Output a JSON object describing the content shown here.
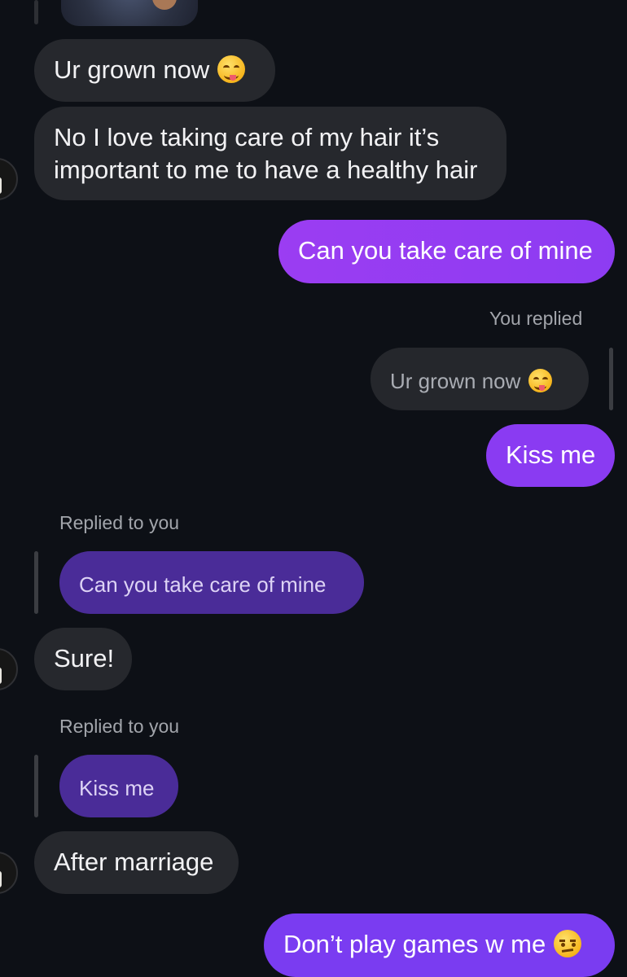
{
  "messages": {
    "m1": "Ur grown now",
    "m2_line1": "No I love taking care of my hair it’s",
    "m2_line2": "important to me to have a healthy hair",
    "m3": "Can you take care of mine",
    "m4_label": "You replied",
    "m4_quote": "Ur grown now",
    "m5": "Kiss me",
    "m6_label": "Replied to you",
    "m6_quote": "Can you take care of mine",
    "m7": "Sure!",
    "m8_label": "Replied to you",
    "m8_quote": "Kiss me",
    "m9": "After marriage",
    "m10": "Don’t play games w me"
  },
  "colors": {
    "background": "#0d1016",
    "incoming": "#26282d",
    "outgoing_purple_start": "#9b3df2",
    "outgoing_purple_end": "#7c3af1",
    "quoted_incoming": "#4a2c98"
  },
  "emoji": {
    "yum": "face-savoring-food-icon",
    "unamused": "unamused-face-icon"
  }
}
